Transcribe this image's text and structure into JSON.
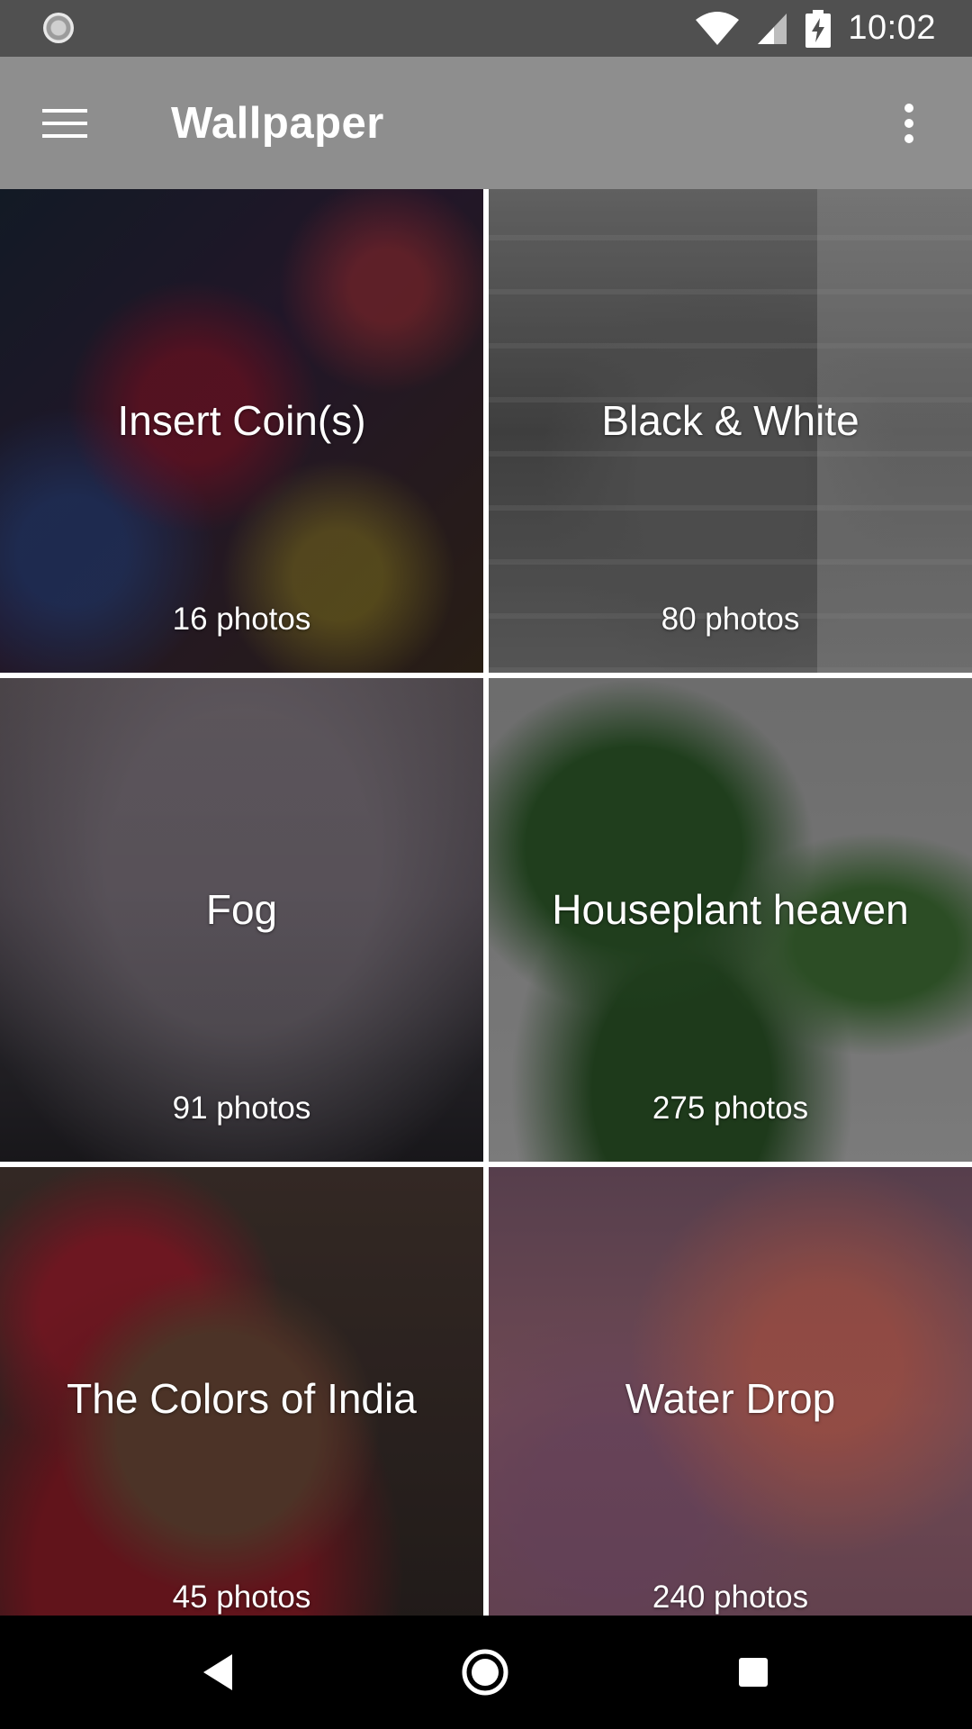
{
  "status_bar": {
    "time": "10:02",
    "left_icon": "sync-indicator-icon",
    "icons": [
      "wifi-icon",
      "signal-icon",
      "battery-charging-icon"
    ]
  },
  "app_bar": {
    "title": "Wallpaper",
    "menu_icon": "hamburger-menu-icon",
    "overflow_icon": "more-vert-icon"
  },
  "collections": [
    {
      "title": "Insert Coin(s)",
      "count": "16 photos"
    },
    {
      "title": "Black & White",
      "count": "80 photos"
    },
    {
      "title": "Fog",
      "count": "91 photos"
    },
    {
      "title": "Houseplant heaven",
      "count": "275 photos"
    },
    {
      "title": "The Colors of India",
      "count": "45 photos"
    },
    {
      "title": "Water Drop",
      "count": "240 photos"
    }
  ],
  "nav_bar": {
    "icons": [
      "back-icon",
      "home-icon",
      "recents-icon"
    ]
  },
  "colors": {
    "status_bar": "#505050",
    "app_bar": "#8e8e8e",
    "nav_bar": "#000000",
    "text": "#ffffff"
  }
}
